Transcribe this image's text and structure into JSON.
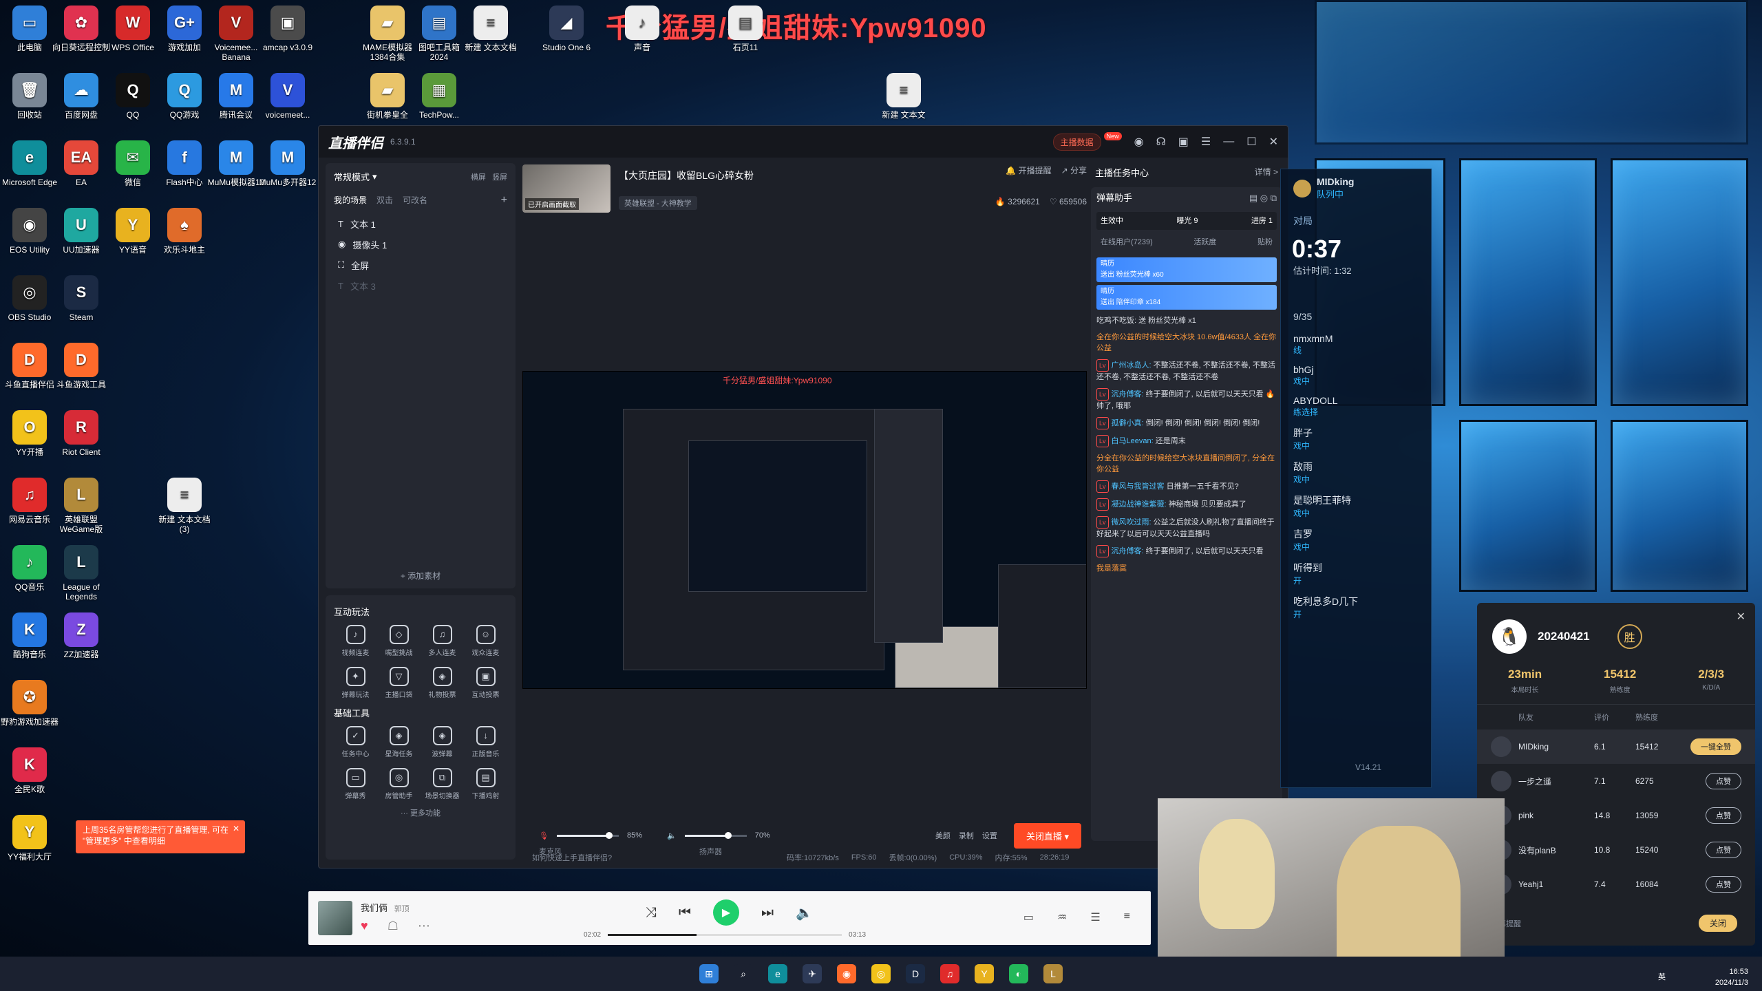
{
  "watermark": "千分猛男/盛姐甜妹:Ypw91090",
  "desktop_icons": [
    {
      "label": "此电脑",
      "glyph": "▭",
      "color": "#2f7fd8"
    },
    {
      "label": "向日葵远程控制",
      "glyph": "✿",
      "color": "#e03250"
    },
    {
      "label": "WPS Office",
      "glyph": "W",
      "color": "#d72a2a"
    },
    {
      "label": "游戏加加",
      "glyph": "G+",
      "color": "#2c68d8"
    },
    {
      "label": "Voicemee... Banana",
      "glyph": "V",
      "color": "#b3261e"
    },
    {
      "label": "amcap v3.0.9",
      "glyph": "▣",
      "color": "#4b4b4b"
    },
    {
      "label": "回收站",
      "glyph": "🗑",
      "color": "#7a8796"
    },
    {
      "label": "百度网盘",
      "glyph": "☁",
      "color": "#2f8ee0"
    },
    {
      "label": "QQ",
      "glyph": "Q",
      "color": "#111"
    },
    {
      "label": "QQ游戏",
      "glyph": "Q",
      "color": "#2c9ae0"
    },
    {
      "label": "腾讯会议",
      "glyph": "M",
      "color": "#2779e8"
    },
    {
      "label": "voicemeet...",
      "glyph": "V",
      "color": "#2d52d8"
    },
    {
      "label": "Microsoft Edge",
      "glyph": "e",
      "color": "#0f8e9b"
    },
    {
      "label": "EA",
      "glyph": "EA",
      "color": "#e5483a"
    },
    {
      "label": "微信",
      "glyph": "✉",
      "color": "#28b448"
    },
    {
      "label": "Flash中心",
      "glyph": "f",
      "color": "#2778e0"
    },
    {
      "label": "MuMu模拟器12",
      "glyph": "M",
      "color": "#2a86e8"
    },
    {
      "label": "MuMu多开器12",
      "glyph": "M",
      "color": "#2a86e8"
    },
    {
      "label": "EOS Utility",
      "glyph": "◉",
      "color": "#444"
    },
    {
      "label": "UU加速器",
      "glyph": "U",
      "color": "#1fa8a0"
    },
    {
      "label": "YY语音",
      "glyph": "Y",
      "color": "#e8b21f"
    },
    {
      "label": "欢乐斗地主",
      "glyph": "♠",
      "color": "#e06b2a"
    },
    {
      "label": "OBS Studio",
      "glyph": "◎",
      "color": "#222"
    },
    {
      "label": "Steam",
      "glyph": "S",
      "color": "#1b2a44"
    },
    {
      "label": "斗鱼直播伴侣",
      "glyph": "D",
      "color": "#ff6a2b"
    },
    {
      "label": "斗鱼游戏工具",
      "glyph": "D",
      "color": "#ff6a2b"
    },
    {
      "label": "YY开播",
      "glyph": "O",
      "color": "#f2c21a"
    },
    {
      "label": "Riot Client",
      "glyph": "R",
      "color": "#d72b37"
    },
    {
      "label": "网易云音乐",
      "glyph": "♫",
      "color": "#e02b2b"
    },
    {
      "label": "英雄联盟WeGame版",
      "glyph": "L",
      "color": "#b28a3a"
    },
    {
      "label": "新建 文本文档 (3)",
      "glyph": "≡",
      "color": "#ededed"
    },
    {
      "label": "QQ音乐",
      "glyph": "♪",
      "color": "#23b85a"
    },
    {
      "label": "League of Legends",
      "glyph": "L",
      "color": "#1c3a4a"
    },
    {
      "label": "酷狗音乐",
      "glyph": "K",
      "color": "#2477e2"
    },
    {
      "label": "ZZ加速器",
      "glyph": "Z",
      "color": "#7a4ae0"
    },
    {
      "label": "野豹游戏加速器",
      "glyph": "✪",
      "color": "#e87a1f"
    },
    {
      "label": "全民K歌",
      "glyph": "K",
      "color": "#e02a4a"
    },
    {
      "label": "YY福利大厅",
      "glyph": "Y",
      "color": "#f2c21a"
    },
    {
      "label": "MAME模拟器1384合集",
      "glyph": "▰",
      "color": "#e9c46a"
    },
    {
      "label": "图吧工具箱2024",
      "glyph": "▤",
      "color": "#2f74c8"
    },
    {
      "label": "新建 文本文档",
      "glyph": "≡",
      "color": "#ededed"
    },
    {
      "label": "Studio One 6",
      "glyph": "◢",
      "color": "#2d3a57"
    },
    {
      "label": "声音",
      "glyph": "♪",
      "color": "#ededed"
    },
    {
      "label": "石页11",
      "glyph": "▤",
      "color": "#ededed"
    },
    {
      "label": "街机拳皇全",
      "glyph": "▰",
      "color": "#e9c46a"
    },
    {
      "label": "TechPow...",
      "glyph": "▦",
      "color": "#5a9a3a"
    },
    {
      "label": "新建 文本文",
      "glyph": "≡",
      "color": "#ededed"
    }
  ],
  "app": {
    "name": "直播伴侣",
    "version": "6.3.9.1",
    "anchor_data": "主播数据",
    "new_badge": "New",
    "scene": {
      "mode": "常规模式",
      "landscape": "横屏",
      "portrait": "竖屏",
      "tabs": [
        "我的场景",
        "双击",
        "可改名"
      ],
      "items": [
        {
          "label": "文本 1",
          "glyph": "T",
          "dim": false
        },
        {
          "label": "摄像头 1",
          "glyph": "◉",
          "dim": false
        },
        {
          "label": "全屏",
          "glyph": "⛶",
          "dim": false
        },
        {
          "label": "文本 3",
          "glyph": "T",
          "dim": true
        }
      ],
      "add_material": "+ 添加素材"
    },
    "interactive": {
      "title": "互动玩法",
      "tools": [
        {
          "label": "视频连麦",
          "glyph": "♪"
        },
        {
          "label": "嘴型挑战",
          "glyph": "◇"
        },
        {
          "label": "多人连麦",
          "glyph": "♫"
        },
        {
          "label": "观众连麦",
          "glyph": "☺"
        },
        {
          "label": "弹幕玩法",
          "glyph": "✦"
        },
        {
          "label": "主播口袋",
          "glyph": "▽"
        },
        {
          "label": "礼物投票",
          "glyph": "◈"
        },
        {
          "label": "互动投票",
          "glyph": "▣"
        }
      ]
    },
    "basic": {
      "title": "基础工具",
      "tools": [
        {
          "label": "任务中心",
          "glyph": "✓"
        },
        {
          "label": "星海任务",
          "glyph": "◈"
        },
        {
          "label": "波弹幕",
          "glyph": "◈"
        },
        {
          "label": "正版音乐",
          "glyph": "↓"
        },
        {
          "label": "弹幕秀",
          "glyph": "▭"
        },
        {
          "label": "房管助手",
          "glyph": "◎"
        },
        {
          "label": "场景切换器",
          "glyph": "⧉"
        },
        {
          "label": "下播鸡射",
          "glyph": "▤"
        }
      ],
      "more": "··· 更多功能"
    },
    "stream": {
      "cover_caption": "已开启画面截取",
      "title": "【大页庄园】收留BLG心碎女粉",
      "tag": "英雄联盟 - 大神教学",
      "open_reminder": "开播提醒",
      "share": "分享",
      "heat": "3296621",
      "likes": "659506"
    },
    "controls": {
      "mic": "麦克风",
      "mic_level": 85,
      "mic_pct": "85%",
      "speaker": "扬声器",
      "speaker_level": 70,
      "speaker_pct": "70%",
      "beauty": "美颜",
      "record": "录制",
      "settings": "设置",
      "end_live": "关闭直播 ▾"
    },
    "status": {
      "help": "如何快速上手直播伴侣?",
      "bitrate": "码率:10727kb/s",
      "fps": "FPS:60",
      "drop": "丢帧:0(0.00%)",
      "cpu": "CPU:39%",
      "mem": "内存:55%",
      "time": "28:26:19"
    },
    "tasks": {
      "title": "主播任务中心",
      "more": "详情 >"
    },
    "danmu": {
      "title": "弹幕助手",
      "live": "生效中",
      "exposure": "曝光 9",
      "entry": "进房 1",
      "online": "在线用户(7239)",
      "active": "活跃度",
      "fans": "贴粉",
      "gifts": [
        {
          "user": "晴历",
          "text": "送出 粉丝荧光棒",
          "count": "x60"
        },
        {
          "user": "晴历",
          "text": "送出 陪伴印章",
          "count": "x184"
        }
      ],
      "messages": [
        {
          "name": "",
          "text": "吃鸡不吃饭: 送 粉丝荧光棒 x1",
          "orange": false
        },
        {
          "name": "",
          "text": "全在你公益的时候给空大冰块 10.6w值/4633人 全在你公益",
          "orange": true
        },
        {
          "name": "广州冰岛人:",
          "text": "不整活还不卷, 不整活还不卷, 不整活还不卷, 不整活还不卷, 不整活还不卷",
          "orange": false
        },
        {
          "name": "沉舟傅客:",
          "text": "终于要倒闭了, 以后就可以天天只看 🔥 帅了, 哦耶",
          "orange": false
        },
        {
          "name": "孤僻小真:",
          "text": "倒闭! 倒闭! 倒闭! 倒闭! 倒闭! 倒闭!",
          "orange": false
        },
        {
          "name": "白马Leevan:",
          "text": "还是周末",
          "orange": false
        },
        {
          "name": "",
          "text": "分全在你公益的时候给空大冰块直播间倒闭了, 分全在你公益",
          "orange": true
        },
        {
          "name": "春风与我皆过客",
          "text": "日推第一五千看不见?",
          "orange": false
        },
        {
          "name": "凝边战神谁紫薇:",
          "text": "神秘商境 贝贝要成真了",
          "orange": false
        },
        {
          "name": "微风吹过雨:",
          "text": "公益之后就没人刷礼物了直播间终于好起来了以后可以天天公益直播吗",
          "orange": false
        },
        {
          "name": "沉舟傅客:",
          "text": "终于要倒闭了, 以后就可以天天只看",
          "orange": false
        },
        {
          "name": "",
          "text": "我是落寞",
          "orange": true
        }
      ]
    }
  },
  "game_client": {
    "user": "MIDking",
    "status": "队列中",
    "match_label": "对局",
    "match_time": "0:37",
    "est_time": "估计时间: 1:32",
    "count": "9/35",
    "players": [
      {
        "name": "nmxmnM",
        "state": "线"
      },
      {
        "name": "bhGj",
        "state": "戏中"
      },
      {
        "name": "ABYDOLL",
        "state": "练选择"
      },
      {
        "name": "胖子",
        "state": "戏中"
      },
      {
        "name": "敌雨",
        "state": "戏中"
      },
      {
        "name": "是聪明王菲特",
        "state": "戏中"
      },
      {
        "name": "吉罗",
        "state": "戏中"
      },
      {
        "name": "听得到",
        "state": "开"
      },
      {
        "name": "吃利息多D几下",
        "state": "开"
      }
    ],
    "version": "V14.21"
  },
  "result": {
    "name": "20240421",
    "win": "胜",
    "stats": [
      {
        "value": "23min",
        "label": "本局时长"
      },
      {
        "value": "15412",
        "label": "熟练度"
      },
      {
        "value": "2/3/3",
        "label": "K/D/A"
      }
    ],
    "cols": [
      "队友",
      "评价",
      "熟练度"
    ],
    "rows": [
      {
        "name": "MIDking",
        "rating": "6.1",
        "mastery": "15412",
        "action": "一键全赞",
        "me": true
      },
      {
        "name": "一步之遥",
        "rating": "7.1",
        "mastery": "6275",
        "action": "点赞",
        "me": false
      },
      {
        "name": "pink",
        "rating": "14.8",
        "mastery": "13059",
        "action": "点赞",
        "me": false
      },
      {
        "name": "没有planB",
        "rating": "10.8",
        "mastery": "15240",
        "action": "点赞",
        "me": false
      },
      {
        "name": "Yeahj1",
        "rating": "7.4",
        "mastery": "16084",
        "action": "点赞",
        "me": false
      }
    ],
    "footer_left": "不再提醒",
    "close": "关闭"
  },
  "music": {
    "title": "我们俩",
    "artist": "郭顶",
    "current": "02:02",
    "total": "03:13",
    "progress": 0.38
  },
  "toast": {
    "text": "上周35名房管帮您进行了直播管理, 可在 \"管理更多\" 中查看明细",
    "close": "✕"
  },
  "taskbar": {
    "icons": [
      "⊞",
      "⌕",
      "e",
      "✈",
      "◉",
      "◎",
      "D",
      "♫",
      "Y",
      "◐",
      "L"
    ],
    "time": "16:53",
    "date": "2024/11/3",
    "ime": "英"
  }
}
